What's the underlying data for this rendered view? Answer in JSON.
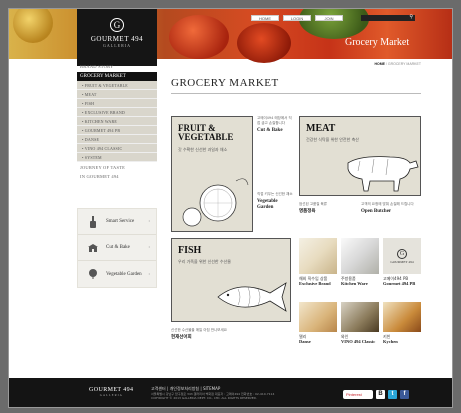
{
  "header": {
    "logo_name": "GOURMET 494",
    "logo_sub": "GALLERIA",
    "logo_mark": "G",
    "top_links": [
      "HOME",
      "LOGIN",
      "JOIN"
    ],
    "search_icon": "search-icon",
    "hero_title": "Grocery Market"
  },
  "sidebar": {
    "brand_story": "BRAND STORY",
    "active": "GROCERY MARKET",
    "sub_items": [
      "• FRUIT & VEGETABLE",
      "• MEAT",
      "• FISH",
      "• EXCLUSIVE BRAND",
      "• KITCHEN WARE",
      "• GOURMET 494 PB",
      "• DANSE",
      "• VINO 494 CLASSIC",
      "• SYSTEM"
    ],
    "journey": "JOURNEY OF TASTE",
    "in_gourmet": "IN GOURMET 494"
  },
  "quick_links": [
    {
      "label": "Smart Service",
      "icon": "hand-icon"
    },
    {
      "label": "Cut & Bake",
      "icon": "store-icon"
    },
    {
      "label": "Vegetable Garden",
      "icon": "plant-icon"
    }
  ],
  "main": {
    "breadcrumb_home": "HOME",
    "breadcrumb_sep": " / ",
    "breadcrumb_current": "GROCERY MARKET",
    "title": "GROCERY MARKET",
    "fruit": {
      "head": "FRUIT & VEGETABLE",
      "desc": "갓 수확한 신선한 과일과 채소"
    },
    "meat": {
      "head": "MEAT",
      "desc": "건강한 식탁을 위한 안전한 축산"
    },
    "fish": {
      "head": "FISH",
      "desc": "우리 가족을 위한 신선한 수산물"
    },
    "cut": {
      "desc": "고메이494 매장에서 직접 굽고 손질합니다",
      "label": "Cut & Bake"
    },
    "veg_garden": {
      "desc": "직접 키우는 신선한 채소",
      "label": "Vegetable Garden"
    },
    "meat_small1": {
      "desc": "엄선된 고품질 육류",
      "label": "명품정육"
    },
    "meat_small2": {
      "desc": "고객의 요청에 맞춰 손질해 드립니다",
      "label": "Open Butcher"
    },
    "fish_note": {
      "desc": "신선한 수산물을 매일 아침 만나보세요",
      "label": "현재선어회"
    },
    "small_tiles": [
      {
        "ko": "해외 직수입 상품",
        "en": "Exclusive Brand"
      },
      {
        "ko": "주방용품",
        "en": "Kitchen Ware"
      },
      {
        "ko": "고메이494 PB",
        "en": "Gourmet 494 PB"
      },
      {
        "ko": "델리",
        "en": "Danse"
      },
      {
        "ko": "와인",
        "en": "VINO 494 Classic"
      },
      {
        "ko": "키친",
        "en": "Kychen"
      }
    ]
  },
  "footer": {
    "logo": "GOURMET 494",
    "logo_sub": "GALLERIA",
    "links": "고객센터 | 개인정보처리방침 | SITEMAP",
    "addr1": "서울특별시 강남구 압구정로 343 갤러리아 백화점   대표자 : 고메이494   전화번호 : 02-410-7114",
    "addr2": "COPYRIGHT © 2013 GALLERIA DEPT. CO., LTD. ALL RIGHTS RESERVED.",
    "pinterest": "Pinterest",
    "social": [
      "B",
      "t",
      "f"
    ],
    "social_colors": [
      "#1f1f1f",
      "#2aa7d8",
      "#3b5998"
    ]
  }
}
